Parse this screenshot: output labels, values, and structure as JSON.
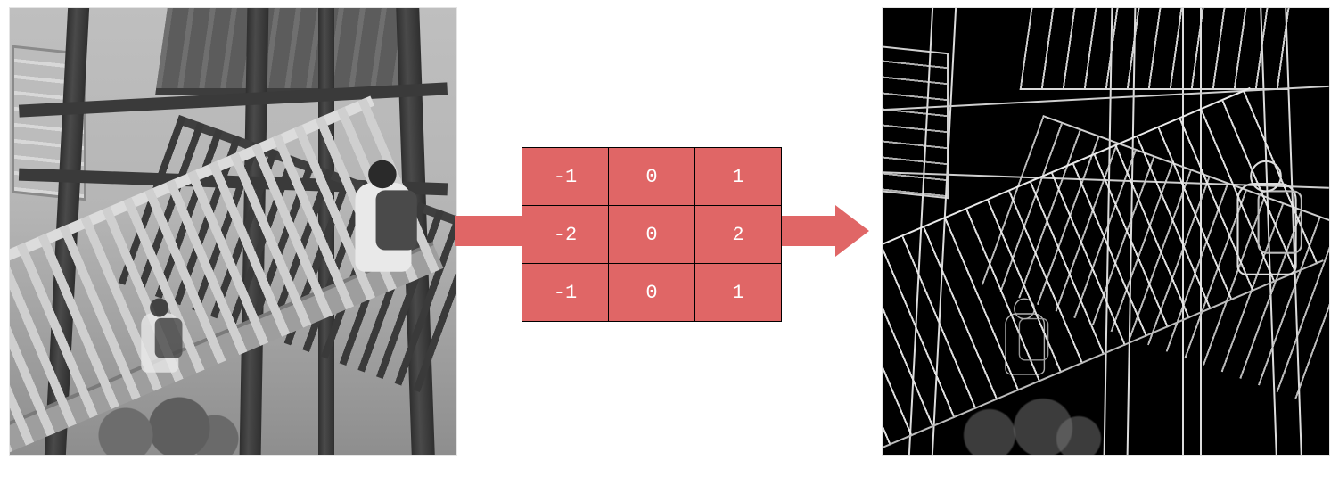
{
  "diagram": {
    "description": "Sobel horizontal edge-detection kernel applied to a grayscale photograph",
    "kernel_color": "#e06666",
    "kernel_text_color": "#ffffff",
    "arrow_color": "#e06666"
  },
  "kernel": {
    "rows": [
      {
        "c0": "-1",
        "c1": "0",
        "c2": "1"
      },
      {
        "c0": "-2",
        "c1": "0",
        "c2": "2"
      },
      {
        "c0": "-1",
        "c1": "0",
        "c2": "1"
      }
    ]
  },
  "chart_data": {
    "type": "table",
    "title": "Sobel Gx (horizontal gradient) convolution kernel",
    "rows": 3,
    "cols": 3,
    "values": [
      [
        -1,
        0,
        1
      ],
      [
        -2,
        0,
        2
      ],
      [
        -1,
        0,
        1
      ]
    ]
  },
  "images": {
    "left_alt": "Grayscale photo looking up at a wooden observation tower with staircases and two people",
    "right_alt": "Edge-detected (Sobel) version of the same photo: white edges on black background"
  }
}
